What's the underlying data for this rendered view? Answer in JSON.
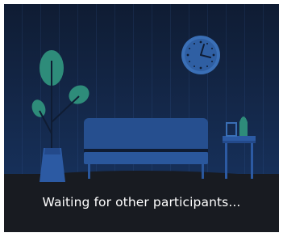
{
  "waiting_room": {
    "status_message": "Waiting for other participants...",
    "icons": {
      "clock": "wall-clock-icon",
      "plant": "potted-plant-icon",
      "sofa": "sofa-icon",
      "side_table": "side-table-icon"
    },
    "colors": {
      "background": "#181b21",
      "wall": "#14284a",
      "furniture": "#264f8f",
      "plant_leaf": "#2e8c7a",
      "clock_face": "#3a6fb6",
      "text": "#ffffff"
    }
  }
}
